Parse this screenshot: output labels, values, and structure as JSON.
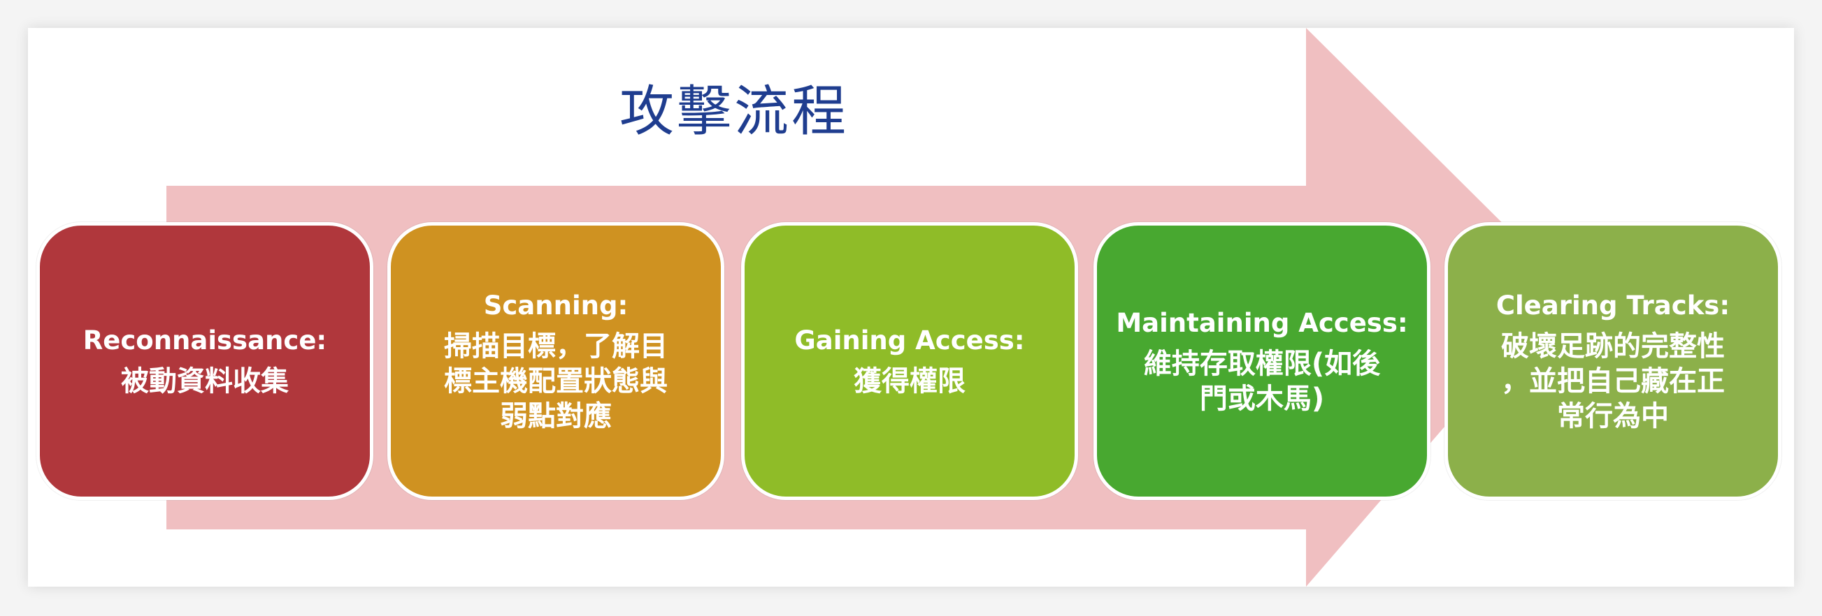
{
  "title": "攻擊流程",
  "colors": {
    "arrow": "#f0bfc1",
    "title": "#1f3d8f"
  },
  "steps": [
    {
      "heading": "Reconnaissance:",
      "description": "被動資料收集",
      "color": "#b0373c"
    },
    {
      "heading": "Scanning:",
      "description": "掃描目標，了解目\n標主機配置狀態與\n弱點對應",
      "color": "#cf9221"
    },
    {
      "heading": "Gaining Access:",
      "description": "獲得權限",
      "color": "#8fbc28"
    },
    {
      "heading": "Maintaining Access:",
      "description": "維持存取權限(如後\n門或木馬)",
      "color": "#48a830"
    },
    {
      "heading": "Clearing Tracks:",
      "description": "破壞足跡的完整性\n，並把自己藏在正\n常行為中",
      "color": "#8cb04a"
    }
  ]
}
